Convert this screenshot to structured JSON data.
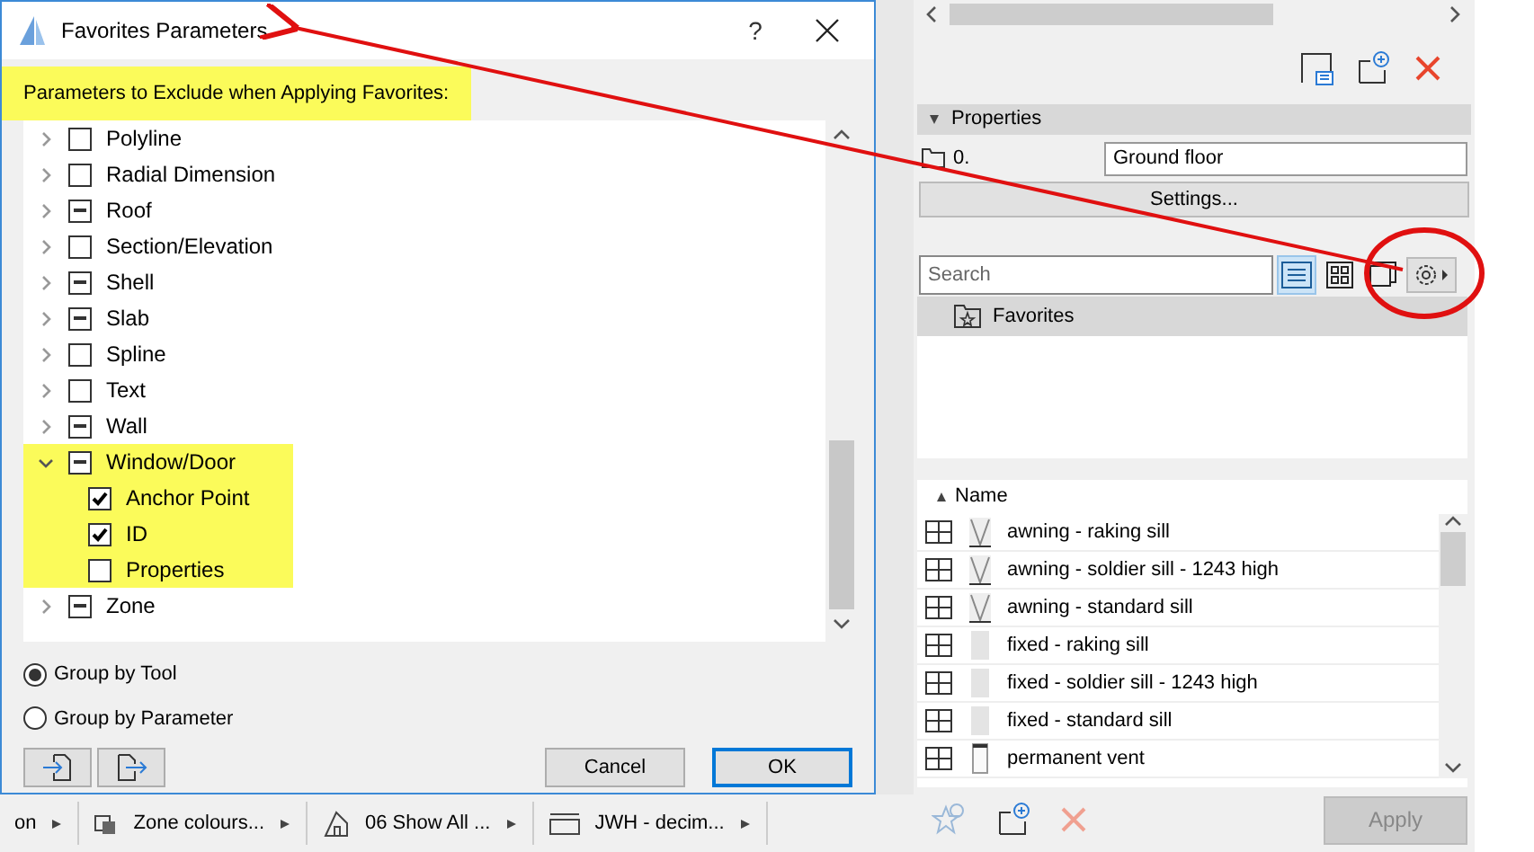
{
  "dialog": {
    "title": "Favorites Parameters",
    "help": "?",
    "heading": "Parameters to Exclude when Applying Favorites:",
    "tree": [
      {
        "label": "Polyline",
        "checked": false,
        "partial": false,
        "expanded": false
      },
      {
        "label": "Radial Dimension",
        "checked": false,
        "partial": false,
        "expanded": false
      },
      {
        "label": "Roof",
        "checked": false,
        "partial": true,
        "expanded": false
      },
      {
        "label": "Section/Elevation",
        "checked": false,
        "partial": false,
        "expanded": false
      },
      {
        "label": "Shell",
        "checked": false,
        "partial": true,
        "expanded": false
      },
      {
        "label": "Slab",
        "checked": false,
        "partial": true,
        "expanded": false
      },
      {
        "label": "Spline",
        "checked": false,
        "partial": false,
        "expanded": false
      },
      {
        "label": "Text",
        "checked": false,
        "partial": false,
        "expanded": false
      },
      {
        "label": "Wall",
        "checked": false,
        "partial": true,
        "expanded": false
      },
      {
        "label": "Window/Door",
        "checked": false,
        "partial": true,
        "expanded": true,
        "highlighted": true,
        "children": [
          {
            "label": "Anchor Point",
            "checked": true,
            "partial": false,
            "highlighted": true
          },
          {
            "label": "ID",
            "checked": true,
            "partial": false,
            "highlighted": true
          },
          {
            "label": "Properties",
            "checked": false,
            "partial": false,
            "highlighted": true
          }
        ]
      },
      {
        "label": "Zone",
        "checked": false,
        "partial": true,
        "expanded": false
      }
    ],
    "radios": [
      {
        "label": "Group by Tool",
        "selected": true
      },
      {
        "label": "Group by Parameter",
        "selected": false
      }
    ],
    "buttons": [
      {
        "label": "Cancel",
        "default": false
      },
      {
        "label": "OK",
        "default": true
      }
    ]
  },
  "taskbar": [
    {
      "label": "on",
      "kind": "none"
    },
    {
      "label": "Zone colours...",
      "kind": "layers"
    },
    {
      "label": "06 Show All ...",
      "kind": "house"
    },
    {
      "label": "JWH - decim...",
      "kind": "dimension"
    }
  ],
  "panel": {
    "properties_header": "Properties",
    "floor_number": "0.",
    "floor_name": "Ground floor",
    "settings_button": "Settings...",
    "search": {
      "placeholder": "Search"
    },
    "view_buttons": [
      {
        "kind": "list",
        "selected": true
      },
      {
        "kind": "grid",
        "selected": false
      },
      {
        "kind": "preview",
        "selected": false
      }
    ],
    "favorites_folder": "Favorites",
    "column": "Name",
    "rows": [
      {
        "name": "awning - raking sill",
        "kind": "awning"
      },
      {
        "name": "awning - soldier sill - 1243 high",
        "kind": "awning"
      },
      {
        "name": "awning - standard sill",
        "kind": "awning"
      },
      {
        "name": "fixed - raking sill",
        "kind": "fixed"
      },
      {
        "name": "fixed - soldier sill - 1243 high",
        "kind": "fixed"
      },
      {
        "name": "fixed - standard sill",
        "kind": "fixed"
      },
      {
        "name": "permanent vent",
        "kind": "vent"
      }
    ],
    "apply_button": {
      "label": "Apply",
      "disabled": true
    }
  }
}
